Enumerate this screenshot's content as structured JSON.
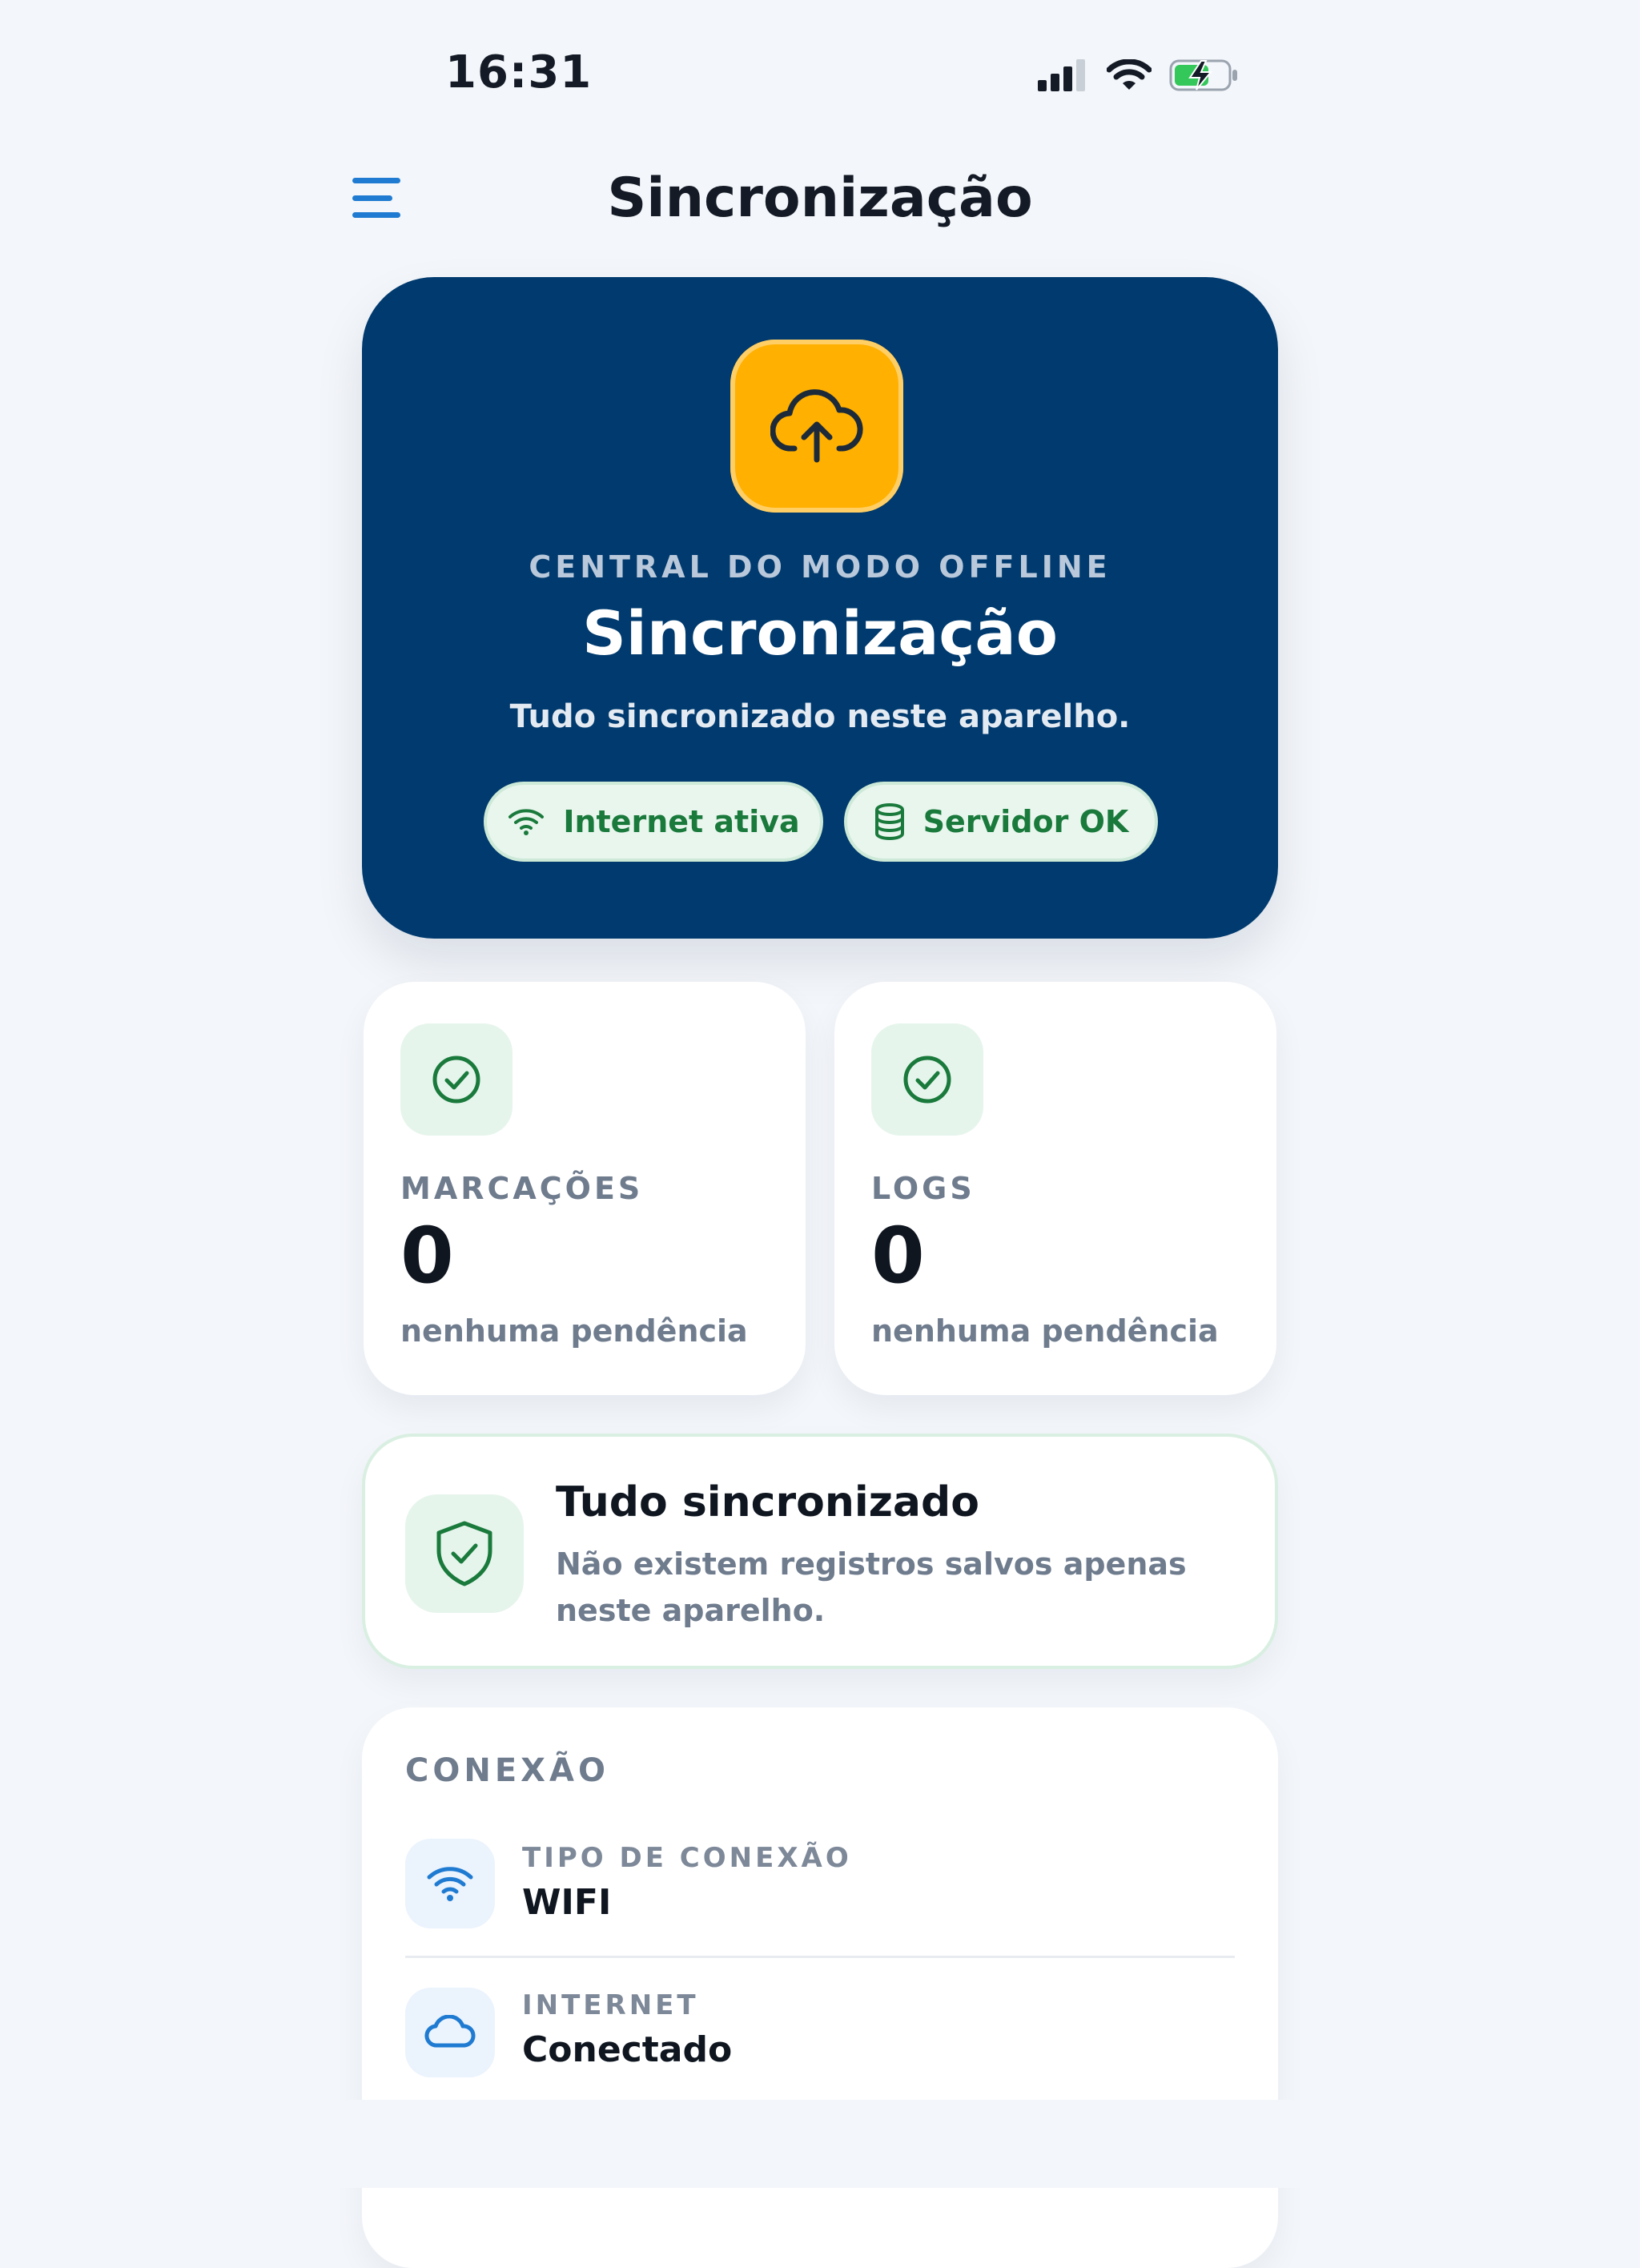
{
  "status_bar": {
    "time": "16:31"
  },
  "nav": {
    "title": "Sincronização"
  },
  "hero": {
    "eyebrow": "CENTRAL DO MODO OFFLINE",
    "title": "Sincronização",
    "subtitle": "Tudo sincronizado neste aparelho.",
    "chips": [
      {
        "label": "Internet ativa",
        "icon": "wifi-icon"
      },
      {
        "label": "Servidor OK",
        "icon": "database-icon"
      }
    ]
  },
  "stats": [
    {
      "label": "MARCAÇÕES",
      "value": "0",
      "note": "nenhuma pendência",
      "icon": "check-circle-icon"
    },
    {
      "label": "LOGS",
      "value": "0",
      "note": "nenhuma pendência",
      "icon": "check-circle-icon"
    }
  ],
  "sync_status": {
    "title": "Tudo sincronizado",
    "description": "Não existem registros salvos apenas neste aparelho.",
    "icon": "shield-check-icon"
  },
  "connection": {
    "heading": "CONEXÃO",
    "rows": [
      {
        "label": "TIPO DE CONEXÃO",
        "value": "WIFI",
        "icon": "wifi-icon"
      },
      {
        "label": "INTERNET",
        "value": "Conectado",
        "icon": "cloud-icon"
      }
    ]
  },
  "colors": {
    "background": "#f3f6fa",
    "hero": "#003a6e",
    "accent": "#ffb000",
    "success": "#1a7a3c",
    "link": "#1f7bd1"
  }
}
